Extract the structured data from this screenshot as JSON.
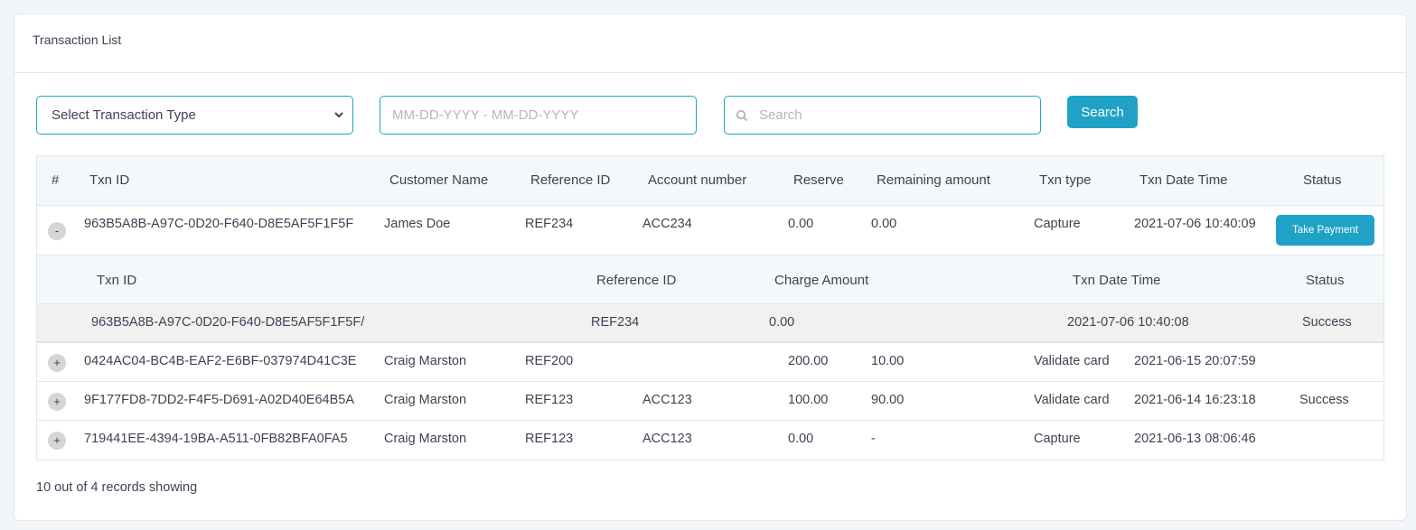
{
  "card": {
    "title": "Transaction List"
  },
  "filters": {
    "type_select": "Select Transaction Type",
    "date_placeholder": "MM-DD-YYYY - MM-DD-YYYY",
    "search_placeholder": "Search",
    "search_button": "Search"
  },
  "table": {
    "headers": {
      "num": "#",
      "txn_id": "Txn ID",
      "customer": "Customer Name",
      "ref": "Reference ID",
      "account": "Account number",
      "reserve": "Reserve",
      "remaining": "Remaining amount",
      "type": "Txn type",
      "datetime": "Txn Date Time",
      "status": "Status"
    },
    "rows": [
      {
        "toggle": "-",
        "txn_id": "963B5A8B-A97C-0D20-F640-D8E5AF5F1F5F",
        "customer": "James Doe",
        "ref": "REF234",
        "account": "ACC234",
        "reserve": "0.00",
        "remaining": "0.00",
        "type": "Capture",
        "datetime": "2021-07-06 10:40:09",
        "status": "",
        "action": "Take Payment"
      },
      {
        "toggle": "+",
        "txn_id": "0424AC04-BC4B-EAF2-E6BF-037974D41C3E",
        "customer": "Craig Marston",
        "ref": "REF200",
        "account": "",
        "reserve": "200.00",
        "remaining": "10.00",
        "type": "Validate card",
        "datetime": "2021-06-15 20:07:59",
        "status": ""
      },
      {
        "toggle": "+",
        "txn_id": "9F177FD8-7DD2-F4F5-D691-A02D40E64B5A",
        "customer": "Craig Marston",
        "ref": "REF123",
        "account": "ACC123",
        "reserve": "100.00",
        "remaining": "90.00",
        "type": "Validate card",
        "datetime": "2021-06-14 16:23:18",
        "status": "Success"
      },
      {
        "toggle": "+",
        "txn_id": "719441EE-4394-19BA-A511-0FB82BFA0FA5",
        "customer": "Craig Marston",
        "ref": "REF123",
        "account": "ACC123",
        "reserve": "0.00",
        "remaining": "-",
        "type": "Capture",
        "datetime": "2021-06-13 08:06:46",
        "status": ""
      }
    ],
    "subtable": {
      "headers": {
        "txn_id": "Txn ID",
        "ref": "Reference ID",
        "charge": "Charge Amount",
        "datetime": "Txn Date Time",
        "status": "Status"
      },
      "rows": [
        {
          "txn_id": "963B5A8B-A97C-0D20-F640-D8E5AF5F1F5F/",
          "ref": "REF234",
          "charge": "0.00",
          "datetime": "2021-07-06 10:40:08",
          "status": "Success"
        }
      ]
    }
  },
  "footer": {
    "records": "10 out of 4 records showing"
  },
  "colors": {
    "accent": "#1fa2c6",
    "header_bg": "#f3f8fb",
    "sub_row_bg": "#f1f1f1"
  },
  "icons": {
    "select_chevron": "chevron-down-icon",
    "search": "search-icon"
  }
}
